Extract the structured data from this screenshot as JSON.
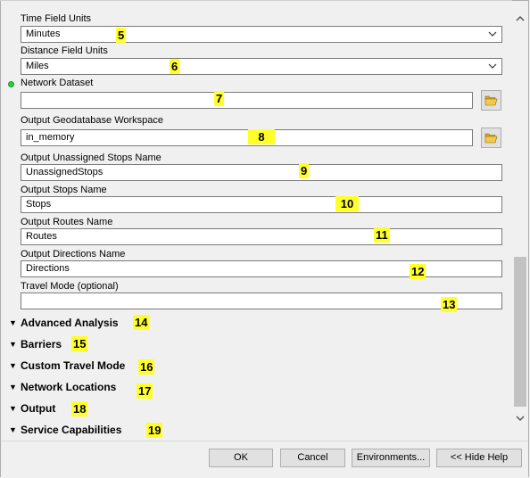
{
  "fields": {
    "time_units": {
      "label": "Time Field Units",
      "value": "Minutes",
      "marker": "5"
    },
    "distance_units": {
      "label": "Distance Field Units",
      "value": "Miles",
      "marker": "6"
    },
    "network_dataset": {
      "label": "Network Dataset",
      "value": "",
      "marker": "7"
    },
    "output_gdb": {
      "label": "Output Geodatabase Workspace",
      "value": "in_memory",
      "marker": "8"
    },
    "unassigned_stops": {
      "label": "Output Unassigned Stops Name",
      "value": "UnassignedStops",
      "marker": "9"
    },
    "stops": {
      "label": "Output Stops Name",
      "value": "Stops",
      "marker": "10"
    },
    "routes": {
      "label": "Output Routes Name",
      "value": "Routes",
      "marker": "11"
    },
    "directions": {
      "label": "Output Directions Name",
      "value": "Directions",
      "marker": "12"
    },
    "travel_mode": {
      "label": "Travel Mode (optional)",
      "value": "",
      "marker": "13"
    }
  },
  "sections": [
    {
      "label": "Advanced Analysis",
      "marker": "14"
    },
    {
      "label": "Barriers",
      "marker": "15"
    },
    {
      "label": "Custom Travel Mode",
      "marker": "16"
    },
    {
      "label": "Network Locations",
      "marker": "17"
    },
    {
      "label": "Output",
      "marker": "18"
    },
    {
      "label": "Service Capabilities",
      "marker": "19"
    }
  ],
  "buttons": {
    "ok": "OK",
    "cancel": "Cancel",
    "environments": "Environments...",
    "hide_help": "<< Hide Help"
  },
  "icons": {
    "dropdown": "chevron-down-icon",
    "folder": "open-folder-icon",
    "section": "double-chevron-down-icon",
    "required": "green-dot-icon"
  },
  "colors": {
    "highlight": "#ffff2a",
    "required_dot": "#2ecc40",
    "background": "#f0f0f0"
  }
}
